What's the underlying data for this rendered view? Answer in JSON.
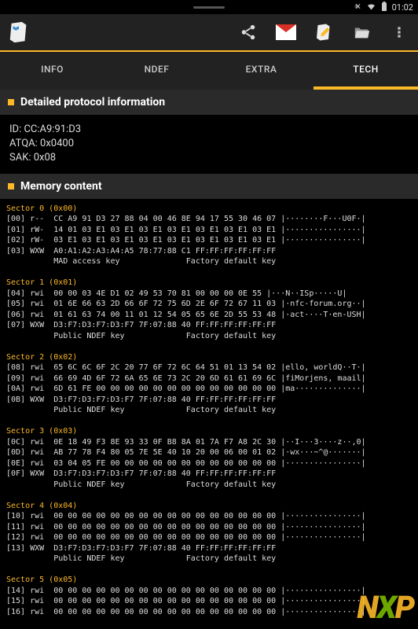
{
  "statusbar": {
    "time": "01:02"
  },
  "tabs": [
    {
      "label": "INFO",
      "active": false
    },
    {
      "label": "NDEF",
      "active": false
    },
    {
      "label": "EXTRA",
      "active": false
    },
    {
      "label": "TECH",
      "active": true
    }
  ],
  "sections": {
    "protocol": {
      "title": "Detailed protocol information",
      "lines": [
        "ID: CC:A9:91:D3",
        "ATQA: 0x0400",
        "SAK: 0x08"
      ]
    },
    "memory": {
      "title": "Memory content",
      "sectors": [
        {
          "title": "Sector 0 (0x00)",
          "rows": [
            "[00] r--  CC A9 91 D3 27 88 04 00 46 8E 94 17 55 30 46 07 |········F···U0F·|",
            "[01] rW-  14 01 03 E1 03 E1 03 E1 03 E1 03 E1 03 E1 03 E1 |················|",
            "[02] rW-  03 E1 03 E1 03 E1 03 E1 03 E1 03 E1 03 E1 03 E1 |················|",
            "[03] WXW  A0:A1:A2:A3:A4:A5 78:77:88 C1 FF:FF:FF:FF:FF:FF",
            "          MAD access key              Factory default key"
          ]
        },
        {
          "title": "Sector 1 (0x01)",
          "rows": [
            "[04] rwi  00 00 03 4E D1 02 49 53 70 81 00 00 00 0E 55 |···N··ISp·····U|",
            "[05] rwi  01 6E 66 63 2D 66 6F 72 75 6D 2E 6F 72 67 11 03 |·nfc-forum.org··|",
            "[06] rwi  01 61 63 74 00 11 01 12 54 05 65 6E 2D 55 53 48 |·act····T·en-USH|",
            "[07] WXW  D3:F7:D3:F7:D3:F7 7F:07:88 40 FF:FF:FF:FF:FF:FF",
            "          Public NDEF key             Factory default key"
          ]
        },
        {
          "title": "Sector 2 (0x02)",
          "rows": [
            "[08] rwi  65 6C 6C 6F 2C 20 77 6F 72 6C 64 51 01 13 54 02 |ello, worldQ··T·|",
            "[09] rwi  66 69 4D 6F 72 6A 65 6E 73 2C 20 6D 61 61 69 6C |fiMorjens, maail|",
            "[0A] rwi  6D 61 FE 00 00 00 00 00 00 00 00 00 00 00 00 00 |ma··············|",
            "[0B] WXW  D3:F7:D3:F7:D3:F7 7F:07:88 40 FF:FF:FF:FF:FF:FF",
            "          Public NDEF key             Factory default key"
          ]
        },
        {
          "title": "Sector 3 (0x03)",
          "rows": [
            "[0C] rwi  0E 18 49 F3 8E 93 33 0F B8 8A 01 7A F7 A8 2C 30 |··I···3····z··,0|",
            "[0D] rwi  AB 77 78 F4 80 05 7E 5E 40 10 20 00 06 00 01 02 |·wx···~^@·······|",
            "[0E] rwi  03 04 05 FE 00 00 00 00 00 00 00 00 00 00 00 00 |················|",
            "[0F] WXW  D3:F7:D3:F7:D3:F7 7F:07:88 40 FF:FF:FF:FF:FF:FF",
            "          Public NDEF key             Factory default key"
          ]
        },
        {
          "title": "Sector 4 (0x04)",
          "rows": [
            "[10] rwi  00 00 00 00 00 00 00 00 00 00 00 00 00 00 00 00 |················|",
            "[11] rwi  00 00 00 00 00 00 00 00 00 00 00 00 00 00 00 00 |················|",
            "[12] rwi  00 00 00 00 00 00 00 00 00 00 00 00 00 00 00 00 |················|",
            "[13] WXW  D3:F7:D3:F7:D3:F7 7F:07:88 40 FF:FF:FF:FF:FF:FF",
            "          Public NDEF key             Factory default key"
          ]
        },
        {
          "title": "Sector 5 (0x05)",
          "rows": [
            "[14] rwi  00 00 00 00 00 00 00 00 00 00 00 00 00 00 00 00 |················|",
            "[15] rwi  00 00 00 00 00 00 00 00 00 00 00 00 00 00 00 00 |················|",
            "[16] rwi  00 00 00 00 00 00 00 00 00 00 00 00 00 00 00 00 |················|"
          ]
        }
      ]
    }
  },
  "watermark": "NXP"
}
